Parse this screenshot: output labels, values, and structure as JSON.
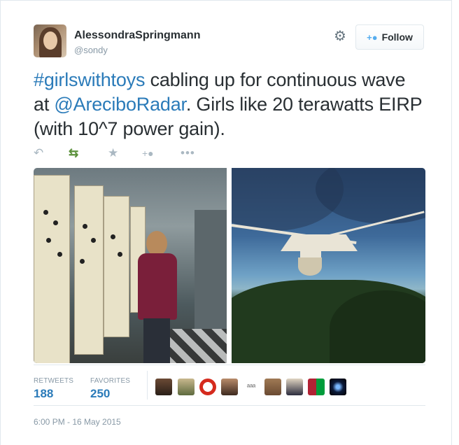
{
  "user": {
    "name": "AlessondraSpringmann",
    "handle": "@sondy"
  },
  "follow_button": {
    "label": "Follow",
    "icon": "add-user-icon"
  },
  "settings_icon": "gear-icon",
  "tweet": {
    "hashtag": "#girlswithtoys",
    "text_part1": " cabling up for continuous wave at ",
    "mention": "@AreciboRadar",
    "text_part2": ". Girls like 20 terawatts EIRP (with 10^7 power gain)."
  },
  "actions": [
    {
      "name": "reply",
      "icon": "reply-icon"
    },
    {
      "name": "retweet",
      "icon": "retweet-icon",
      "color": "#5c913b"
    },
    {
      "name": "favorite",
      "icon": "star-icon"
    },
    {
      "name": "follow",
      "icon": "add-user-icon"
    },
    {
      "name": "more",
      "icon": "more-icon"
    }
  ],
  "media": [
    {
      "name": "photo-control-room",
      "icon": "photo"
    },
    {
      "name": "photo-arecibo-telescope",
      "icon": "photo"
    }
  ],
  "stats": {
    "retweets_label": "RETWEETS",
    "retweets_count": "188",
    "favorites_label": "FAVORITES",
    "favorites_count": "250"
  },
  "favoriters_count": 9,
  "timestamp": "6:00 PM - 16 May 2015",
  "colors": {
    "link": "#2b7bb9",
    "muted": "#8899a6",
    "border": "#e1e8ed",
    "text": "#292f33"
  }
}
